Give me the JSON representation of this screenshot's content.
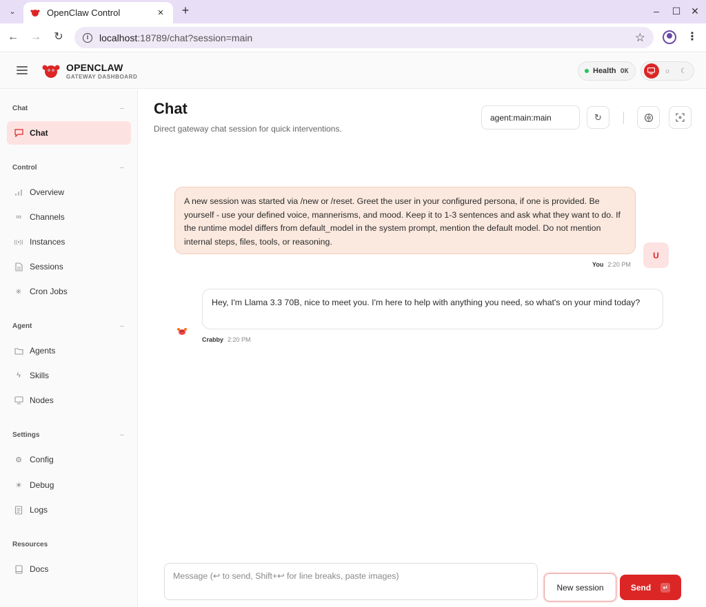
{
  "browser": {
    "tab_title": "OpenClaw Control",
    "url_host": "localhost",
    "url_path": ":18789/chat?session=main"
  },
  "header": {
    "brand": "OPENCLAW",
    "brand_sub": "GATEWAY DASHBOARD",
    "health_label": "Health",
    "health_status": "OK",
    "health_color": "#22c55e",
    "accent_color": "#dc2626"
  },
  "sidebar": {
    "sections": [
      {
        "title": "Chat",
        "items": [
          {
            "label": "Chat",
            "icon": "chat-icon",
            "active": true
          }
        ]
      },
      {
        "title": "Control",
        "items": [
          {
            "label": "Overview",
            "icon": "bar-chart-icon"
          },
          {
            "label": "Channels",
            "icon": "link-icon"
          },
          {
            "label": "Instances",
            "icon": "radio-icon"
          },
          {
            "label": "Sessions",
            "icon": "document-icon"
          },
          {
            "label": "Cron Jobs",
            "icon": "loader-icon"
          }
        ]
      },
      {
        "title": "Agent",
        "items": [
          {
            "label": "Agents",
            "icon": "folder-icon"
          },
          {
            "label": "Skills",
            "icon": "bolt-icon"
          },
          {
            "label": "Nodes",
            "icon": "monitor-icon"
          }
        ]
      },
      {
        "title": "Settings",
        "items": [
          {
            "label": "Config",
            "icon": "gear-icon"
          },
          {
            "label": "Debug",
            "icon": "bug-icon"
          },
          {
            "label": "Logs",
            "icon": "scroll-icon"
          }
        ]
      },
      {
        "title": "Resources",
        "items": [
          {
            "label": "Docs",
            "icon": "book-icon"
          }
        ]
      }
    ]
  },
  "main": {
    "title": "Chat",
    "subtitle": "Direct gateway chat session for quick interventions.",
    "session_key": "agent:main:main",
    "messages": [
      {
        "role": "user",
        "text": "A new session was started via /new or /reset. Greet the user in your configured persona, if one is provided. Be yourself - use your defined voice, mannerisms, and mood. Keep it to 1-3 sentences and ask what they want to do. If the runtime model differs from default_model in the system prompt, mention the default model. Do not mention internal steps, files, tools, or reasoning.",
        "sender": "You",
        "time": "2:20 PM",
        "avatar": "U"
      },
      {
        "role": "assistant",
        "text": "Hey, I'm Llama 3.3 70B, nice to meet you. I'm here to help with anything you need, so what's on your mind today?",
        "sender": "Crabby",
        "time": "2:20 PM"
      }
    ],
    "composer_placeholder": "Message (↩ to send, Shift+↩ for line breaks, paste images)",
    "new_session_label": "New session",
    "send_label": "Send"
  }
}
